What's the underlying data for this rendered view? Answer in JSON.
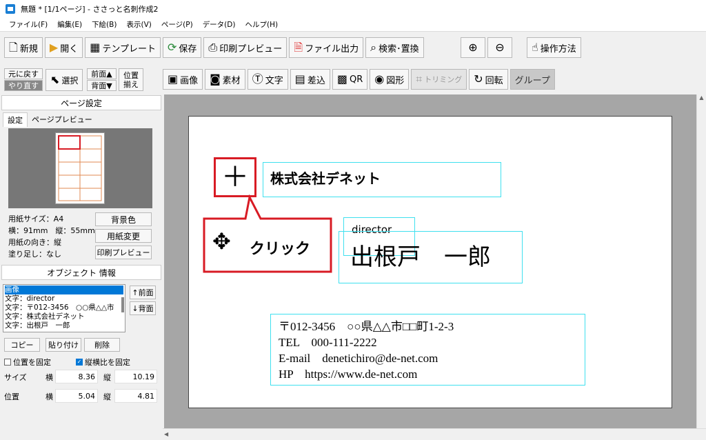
{
  "window": {
    "title": "無題 * [1/1ページ] - ささっと名刺作成2"
  },
  "menu": [
    "ファイル(F)",
    "編集(E)",
    "下絵(B)",
    "表示(V)",
    "ページ(P)",
    "データ(D)",
    "ヘルプ(H)"
  ],
  "toolbar1": {
    "new": "新規",
    "open": "開く",
    "template": "テンプレート",
    "save": "保存",
    "print_preview": "印刷プレビュー",
    "file_output": "ファイル出力",
    "search_replace": "検索･置換",
    "usage": "操作方法"
  },
  "toolbar2": {
    "undo": "元に戻す",
    "redo": "やり直す",
    "select": "選択",
    "front": "前面▲",
    "back": "背面▼",
    "align1": "位置",
    "align2": "揃え",
    "image": "画像",
    "material": "素材",
    "text": "文字",
    "insert": "差込",
    "qr": "QR",
    "shape": "図形",
    "trimming": "トリミング",
    "rotate": "回転",
    "group": "グループ"
  },
  "page_settings": {
    "header": "ページ設定",
    "tab_settings": "設定",
    "tab_preview": "ページプレビュー",
    "paper_size": "用紙サイズ：A4",
    "dims": "横：91mm　縦：55mm",
    "orientation": "用紙の向き：縦",
    "bleed": "塗り足し：なし",
    "bg_color": "背景色",
    "change_paper": "用紙変更",
    "print_preview": "印刷プレビュー"
  },
  "object_info": {
    "header": "オブジェクト 情報",
    "items": [
      "画像",
      "文字：director",
      "文字：〒012-3456　○○県△△市",
      "文字：株式会社デネット",
      "文字：出根戸　一郎"
    ],
    "front": "↑前面",
    "back": "↓背面",
    "copy": "コピー",
    "paste": "貼り付け",
    "delete": "削除",
    "fix_position": "位置を固定",
    "fix_ratio": "縦横比を固定",
    "size_label": "サイズ",
    "pos_label": "位置",
    "horiz": "横",
    "vert": "縦",
    "size_w": "8.36",
    "size_h": "10.19",
    "pos_x": "5.04",
    "pos_y": "4.81"
  },
  "card": {
    "company": "株式会社デネット",
    "title": "director",
    "name": "出根戸　一郎",
    "address": "〒012-3456　○○県△△市□□町1-2-3",
    "tel": "TEL　000-111-2222",
    "email": "E-mail　denetichiro@de-net.com",
    "hp": "HP　https://www.de-net.com"
  },
  "callout": {
    "label": "クリック",
    "plus": "＋"
  },
  "colors": {
    "accent": "#d81b24",
    "selection": "#3ee0ef"
  }
}
